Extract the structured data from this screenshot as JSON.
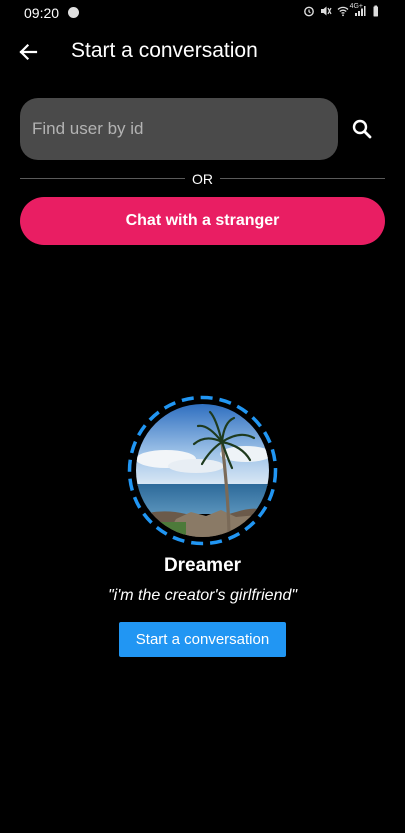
{
  "status_bar": {
    "time": "09:20",
    "network_label": "4G+",
    "icons": [
      "notification-dot-icon",
      "alarm-icon",
      "mute-icon",
      "wifi-icon",
      "signal-icon",
      "battery-icon"
    ]
  },
  "app_bar": {
    "title": "Start a conversation",
    "back_icon": "arrow-back-icon"
  },
  "search": {
    "placeholder": "Find user by id",
    "value": "",
    "icon": "search-icon"
  },
  "divider": {
    "label": "OR"
  },
  "stranger_button": {
    "label": "Chat with a stranger"
  },
  "profile": {
    "name": "Dreamer",
    "bio": "\"i'm the creator's girlfriend\"",
    "start_button_label": "Start a conversation"
  },
  "colors": {
    "background": "#000000",
    "accent_pink": "#e91e63",
    "accent_blue": "#2196f3",
    "search_bg": "#4a4a4a",
    "ring_blue": "#2196f3"
  }
}
